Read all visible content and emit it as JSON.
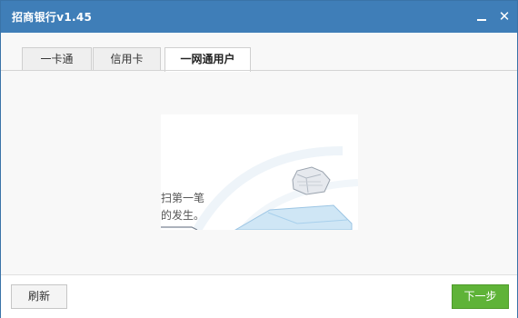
{
  "window": {
    "title": "招商银行v1.45",
    "minimize_icon": "minimize-icon",
    "close_icon": "close-icon",
    "close_glyph": "✕"
  },
  "tabs": [
    {
      "label": "一卡通",
      "active": false
    },
    {
      "label": "信用卡",
      "active": false
    },
    {
      "label": "一网通用户",
      "active": true
    }
  ],
  "main": {
    "partial_text_line1": "扫第一笔",
    "partial_text_line2": "的发生。"
  },
  "footer": {
    "refresh_label": "刷新",
    "next_label": "下一步"
  },
  "colors": {
    "titlebar": "#3f7eb8",
    "next_button": "#5fb338"
  }
}
